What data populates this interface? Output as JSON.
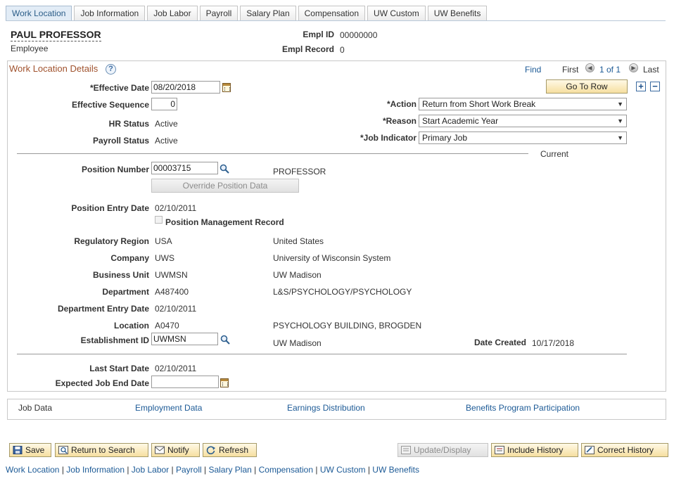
{
  "tabs": [
    {
      "label": "Work Location",
      "active": true
    },
    {
      "label": "Job Information"
    },
    {
      "label": "Job Labor"
    },
    {
      "label": "Payroll"
    },
    {
      "label": "Salary Plan"
    },
    {
      "label": "Compensation"
    },
    {
      "label": "UW Custom"
    },
    {
      "label": "UW Benefits"
    }
  ],
  "header": {
    "name": "PAUL PROFESSOR",
    "role": "Employee",
    "empl_id_label": "Empl ID",
    "empl_id": "00000000",
    "empl_record_label": "Empl Record",
    "empl_record": "0"
  },
  "section": {
    "title": "Work Location Details",
    "find": "Find",
    "first": "First",
    "counter": "1 of 1",
    "last": "Last",
    "go_to_row": "Go To Row",
    "current": "Current"
  },
  "fields": {
    "effective_date_label": "*Effective Date",
    "effective_date": "08/20/2018",
    "effective_sequence_label": "Effective Sequence",
    "effective_sequence": "0",
    "hr_status_label": "HR Status",
    "hr_status": "Active",
    "payroll_status_label": "Payroll Status",
    "payroll_status": "Active",
    "action_label": "*Action",
    "action": "Return from Short Work Break",
    "reason_label": "*Reason",
    "reason": "Start Academic Year",
    "job_indicator_label": "*Job Indicator",
    "job_indicator": "Primary Job",
    "position_number_label": "Position Number",
    "position_number": "00003715",
    "position_desc": "PROFESSOR",
    "override_position": "Override Position Data",
    "position_entry_date_label": "Position Entry Date",
    "position_entry_date": "02/10/2011",
    "position_mgmt_record": "Position Management Record",
    "regulatory_region_label": "Regulatory Region",
    "regulatory_region": "USA",
    "regulatory_region_desc": "United States",
    "company_label": "Company",
    "company": "UWS",
    "company_desc": "University of Wisconsin System",
    "business_unit_label": "Business Unit",
    "business_unit": "UWMSN",
    "business_unit_desc": "UW Madison",
    "department_label": "Department",
    "department": "A487400",
    "department_desc": "L&S/PSYCHOLOGY/PSYCHOLOGY",
    "department_entry_date_label": "Department Entry Date",
    "department_entry_date": "02/10/2011",
    "location_label": "Location",
    "location": "A0470",
    "location_desc": "PSYCHOLOGY BUILDING, BROGDEN",
    "establishment_id_label": "Establishment ID",
    "establishment_id": "UWMSN",
    "establishment_desc": "UW Madison",
    "date_created_label": "Date Created",
    "date_created": "10/17/2018",
    "last_start_date_label": "Last Start Date",
    "last_start_date": "02/10/2011",
    "expected_job_end_date_label": "Expected Job End Date",
    "expected_job_end_date": ""
  },
  "bottom_nav": {
    "job_data": "Job Data",
    "employment_data": "Employment Data",
    "earnings_distribution": "Earnings Distribution",
    "benefits_program": "Benefits Program Participation"
  },
  "toolbar": {
    "save": "Save",
    "return_to_search": "Return to Search",
    "notify": "Notify",
    "refresh": "Refresh",
    "update_display": "Update/Display",
    "include_history": "Include History",
    "correct_history": "Correct History"
  },
  "footer_links": [
    "Work Location",
    "Job Information",
    "Job Labor",
    "Payroll",
    "Salary Plan",
    "Compensation",
    "UW Custom",
    "UW Benefits"
  ],
  "colors": {
    "link": "#1c5a96",
    "section_title": "#a0522d",
    "button_gradient_bottom": "#f6dfa0"
  }
}
